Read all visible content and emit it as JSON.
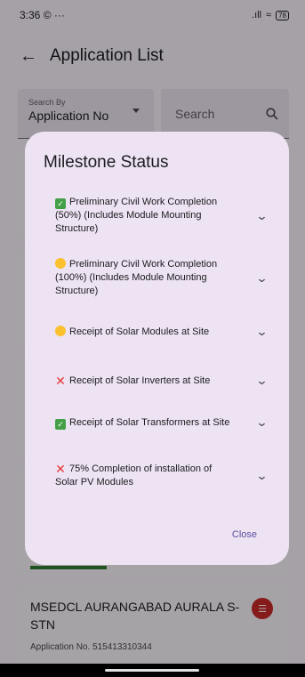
{
  "status_bar": {
    "time": "3:36",
    "left_icons": "© ···",
    "signal": ".ıll",
    "wifi": "≈",
    "battery": "78"
  },
  "app_bar": {
    "title": "Application List"
  },
  "search": {
    "by_label": "Search By",
    "by_value": "Application No",
    "placeholder": "Search"
  },
  "dialog": {
    "title": "Milestone Status",
    "close_label": "Close",
    "milestones": [
      {
        "status": "done",
        "text": "Preliminary Civil Work Completion (50%) (Includes Module Mounting Structure)"
      },
      {
        "status": "in-progress",
        "text": "Preliminary Civil Work Completion (100%) (Includes Module Mounting Structure)"
      },
      {
        "status": "in-progress",
        "text": "Receipt of Solar Modules at Site"
      },
      {
        "status": "not-done",
        "text": "Receipt of Solar Inverters at Site"
      },
      {
        "status": "done",
        "text": "Receipt of Solar Transformers at Site"
      },
      {
        "status": "not-done",
        "text": "75% Completion of installation of Solar PV Modules"
      }
    ]
  },
  "bottom_card": {
    "title": "MSEDCL AURANGABAD AURALA S-STN",
    "subtitle": "Application No. 515413310344"
  }
}
